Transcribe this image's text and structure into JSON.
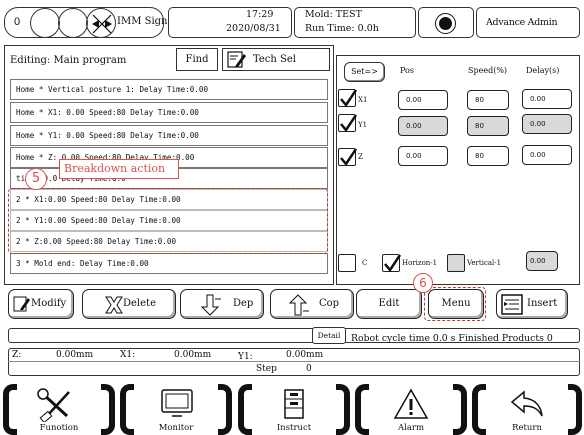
{
  "header": {
    "counter": "0",
    "imm_signal": "IMM Signal",
    "time": "17:29",
    "date": "2020/08/31",
    "mold_label": "Mold: TEST",
    "run_time": "Run Time: 0.0h",
    "user": "Advance Admin"
  },
  "program": {
    "editing": "Editing: Main program",
    "find": "Find",
    "tech_sel": "Tech Sel",
    "rows": [
      "Home   *  Vertical posture 1: Delay Time:0.00",
      "Home   *  X1: 0.00 Speed:80  Delay Time:0.00",
      "Home   *  Y1: 0.00 Speed:80  Delay Time:0.00",
      "Home   *  Z: 0.00 Speed:80  Delay Time:0.00",
      "                              time:50.0  Delay Time:0.0",
      "2      *   X1:0.00    Speed:80   Delay Time:0.00",
      "2      *   Y1:0.00    Speed:80   Delay Time:0.00",
      "2      *   Z:0.00    Speed:80   Delay Time:0.00",
      "3      *   Mold end:  Delay Time:0.00"
    ]
  },
  "annotations": {
    "callout5_number": "5",
    "callout5_text": "Breakdown action",
    "callout6_number": "6"
  },
  "axis_panel": {
    "set_button": "Set=>",
    "col_pos": "Pos",
    "col_speed": "Speed(%)",
    "col_delay": "Delay(s)",
    "axes": [
      {
        "label": "X1",
        "pos": "0.00",
        "speed": "80",
        "delay": "0.00",
        "checked": true,
        "disabled": false
      },
      {
        "label": "Y1",
        "pos": "0.00",
        "speed": "80",
        "delay": "0.00",
        "checked": true,
        "disabled": true
      },
      {
        "label": "Z",
        "pos": "0.00",
        "speed": "80",
        "delay": "0.00",
        "checked": true,
        "disabled": false
      }
    ],
    "c_label": "C",
    "horizon_label": "Horizon-1",
    "vertical_label": "Vertical-1",
    "posture_delay": "0.00"
  },
  "toolbar": {
    "modify": "Modify",
    "delete": "Delete",
    "dep": "Dep",
    "cop": "Cop",
    "edit": "Edit",
    "menu": "Menu",
    "insert": "Insert"
  },
  "status": {
    "detail": "Detail",
    "cycle_text": "Robot cycle time 0.0 s Finished Products  0",
    "z_label": "Z:",
    "z_value": "0.00mm",
    "x1_label": "X1:",
    "x1_value": "0.00mm",
    "y1_label": "Y1:",
    "y1_value": "0.00mm",
    "step_label": "Step",
    "step_value": "0"
  },
  "nav": {
    "function": "Funotion",
    "monitor": "Monitor",
    "instruct": "Instruct",
    "alarm": "Alarm",
    "return": "Return"
  }
}
